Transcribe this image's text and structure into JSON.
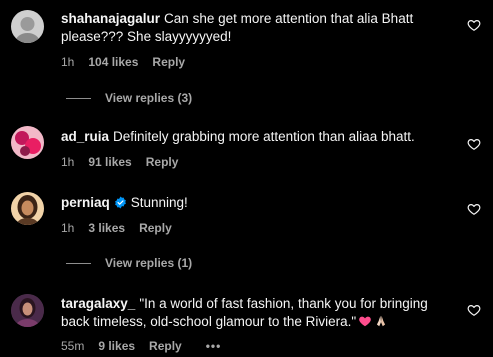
{
  "comments": [
    {
      "username": "shahanajagalur",
      "text": "Can she get more attention that alia Bhatt please??? She slayyyyyyed!",
      "time": "1h",
      "likes": "104 likes",
      "reply": "Reply",
      "view_replies": "View replies (3)",
      "avatar_icon": "grey-face-avatar"
    },
    {
      "username": "ad_ruia",
      "text": "Definitely grabbing more attention than aliaa bhatt.",
      "time": "1h",
      "likes": "91 likes",
      "reply": "Reply",
      "avatar_icon": "pink-abstract-avatar"
    },
    {
      "username": "perniaq",
      "text": "Stunning!",
      "time": "1h",
      "likes": "3 likes",
      "reply": "Reply",
      "view_replies": "View replies (1)",
      "verified": true,
      "avatar_icon": "woman-portrait-avatar"
    },
    {
      "username": "taragalaxy_",
      "text": "\"In a world of fast fashion, thank you for bringing back timeless, old-school glamour to the Riviera.\"",
      "time": "55m",
      "likes": "9 likes",
      "reply": "Reply",
      "more": "•••",
      "emojis": [
        "pink-heart-emoji",
        "praying-hands-emoji"
      ],
      "avatar_icon": "purple-portrait-avatar"
    }
  ],
  "colors": {
    "background": "#000000",
    "text": "#f5f5f5",
    "secondary": "#a8a8a8",
    "verified": "#0095f6",
    "heart_emoji": "#ff4d8d"
  }
}
